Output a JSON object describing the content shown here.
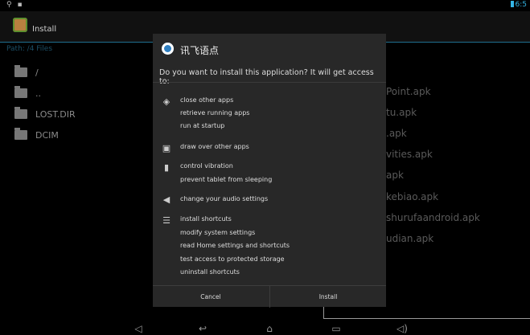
{
  "status_bar": {
    "time": "6:5"
  },
  "action_bar": {
    "title": "Install"
  },
  "path": "Path: /4 Files",
  "files": [
    {
      "name": "/",
      "icon": "folder-up-icon"
    },
    {
      "name": "..",
      "icon": "folder-up-icon"
    },
    {
      "name": "LOST.DIR",
      "icon": "folder-icon"
    },
    {
      "name": "DCIM",
      "icon": "folder-icon"
    }
  ],
  "background_apks": [
    "Point.apk",
    "tu.apk",
    ".apk",
    "vities.apk",
    "apk",
    "kebiao.apk",
    "shurufaandroid.apk",
    "udian.apk"
  ],
  "dialog": {
    "title": "讯飞语点",
    "question": "Do you want to install this application? It will get access to:",
    "permission_groups": [
      {
        "icon": "network-icon",
        "items": [
          "close other apps",
          "retrieve running apps",
          "run at startup"
        ]
      },
      {
        "icon": "window-icon",
        "items": [
          "draw over other apps"
        ]
      },
      {
        "icon": "lock-icon",
        "items": [
          "control vibration",
          "prevent tablet from sleeping"
        ]
      },
      {
        "icon": "speaker-icon",
        "items": [
          "change your audio settings"
        ]
      },
      {
        "icon": "sliders-icon",
        "items": [
          "install shortcuts",
          "modify system settings",
          "read Home settings and shortcuts",
          "test access to protected storage",
          "uninstall shortcuts"
        ]
      }
    ],
    "cancel_label": "Cancel",
    "install_label": "Install"
  },
  "nav_bar": [
    "volume-down-icon",
    "back-icon",
    "home-icon",
    "recents-icon",
    "volume-up-icon"
  ]
}
